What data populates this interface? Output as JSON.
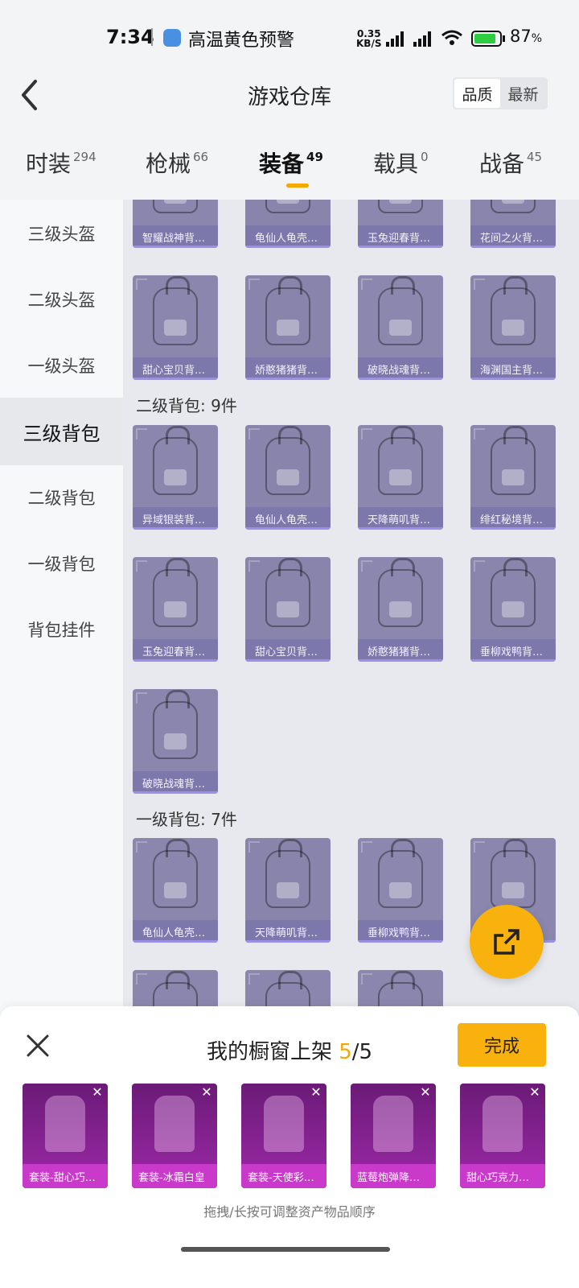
{
  "status": {
    "time": "7:34",
    "alert": "高温黄色预警",
    "speed_value": "0.35",
    "speed_unit": "KB/S",
    "battery_pct": "87",
    "battery_unit": "%",
    "battery_level": 0.87
  },
  "header": {
    "title": "游戏仓库",
    "sort_options": [
      "品质",
      "最新"
    ]
  },
  "tabs": [
    {
      "label": "时装",
      "count": "294"
    },
    {
      "label": "枪械",
      "count": "66"
    },
    {
      "label": "装备",
      "count": "49"
    },
    {
      "label": "载具",
      "count": "0"
    },
    {
      "label": "战备",
      "count": "45"
    }
  ],
  "sidebar": {
    "items": [
      "三级头盔",
      "二级头盔",
      "一级头盔",
      "三级背包",
      "二级背包",
      "一级背包",
      "背包挂件"
    ],
    "active": "三级背包"
  },
  "content": {
    "row_partial": [
      "智耀战神背…",
      "龟仙人龟壳…",
      "玉兔迎春背…",
      "花间之火背…"
    ],
    "row_top": [
      "甜心宝贝背…",
      "娇憨猪猪背…",
      "破晓战魂背…",
      "海渊国主背…"
    ],
    "section2_title": "二级背包: 9件",
    "section2_items": [
      "异域银装背…",
      "龟仙人龟壳…",
      "天降萌叽背…",
      "绯红秘境背…",
      "玉兔迎春背…",
      "甜心宝贝背…",
      "娇憨猪猪背…",
      "垂柳戏鸭背…",
      "破晓战魂背…"
    ],
    "section3_title": "一级背包: 7件",
    "section3_items": [
      "龟仙人龟壳…",
      "天降萌叽背…",
      "垂柳戏鸭背…"
    ]
  },
  "sheet": {
    "title_prefix": "我的橱窗上架 ",
    "current": "5",
    "total_text": "/5",
    "done_label": "完成",
    "items": [
      "套装-甜心巧…",
      "套装-冰霜白皇",
      "套装-天使彩…",
      "蓝莓炮弹降…",
      "甜心巧克力…"
    ],
    "hint": "拖拽/长按可调整资产物品顺序"
  }
}
